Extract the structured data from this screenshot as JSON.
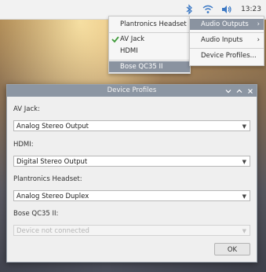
{
  "taskbar": {
    "icons": [
      "bluetooth-icon",
      "wifi-icon",
      "volume-icon"
    ],
    "clock": "13:23",
    "colors": {
      "icon": "#3b78c4"
    }
  },
  "menu_outputs": {
    "items": [
      {
        "label": "Plantronics Headset",
        "checked": false,
        "selected": false
      },
      {
        "label": "AV Jack",
        "checked": true,
        "selected": false
      },
      {
        "label": "HDMI",
        "checked": false,
        "selected": false
      },
      {
        "label": "Bose QC35 II",
        "checked": false,
        "selected": true
      }
    ]
  },
  "menu_main": {
    "items": [
      {
        "label": "Audio Outputs",
        "arrow": "›",
        "selected": true
      },
      {
        "label": "Audio Inputs",
        "arrow": "›",
        "selected": false
      },
      {
        "label": "Device Profiles...",
        "arrow": "",
        "selected": false
      }
    ]
  },
  "dialog": {
    "title": "Device Profiles",
    "devices": [
      {
        "label": "AV Jack:",
        "value": "Analog Stereo Output",
        "enabled": true
      },
      {
        "label": "HDMI:",
        "value": "Digital Stereo Output",
        "enabled": true
      },
      {
        "label": "Plantronics Headset:",
        "value": "Analog Stereo Duplex",
        "enabled": true
      },
      {
        "label": "Bose QC35 II:",
        "value": "Device not connected",
        "enabled": false
      }
    ],
    "ok_label": "OK"
  }
}
